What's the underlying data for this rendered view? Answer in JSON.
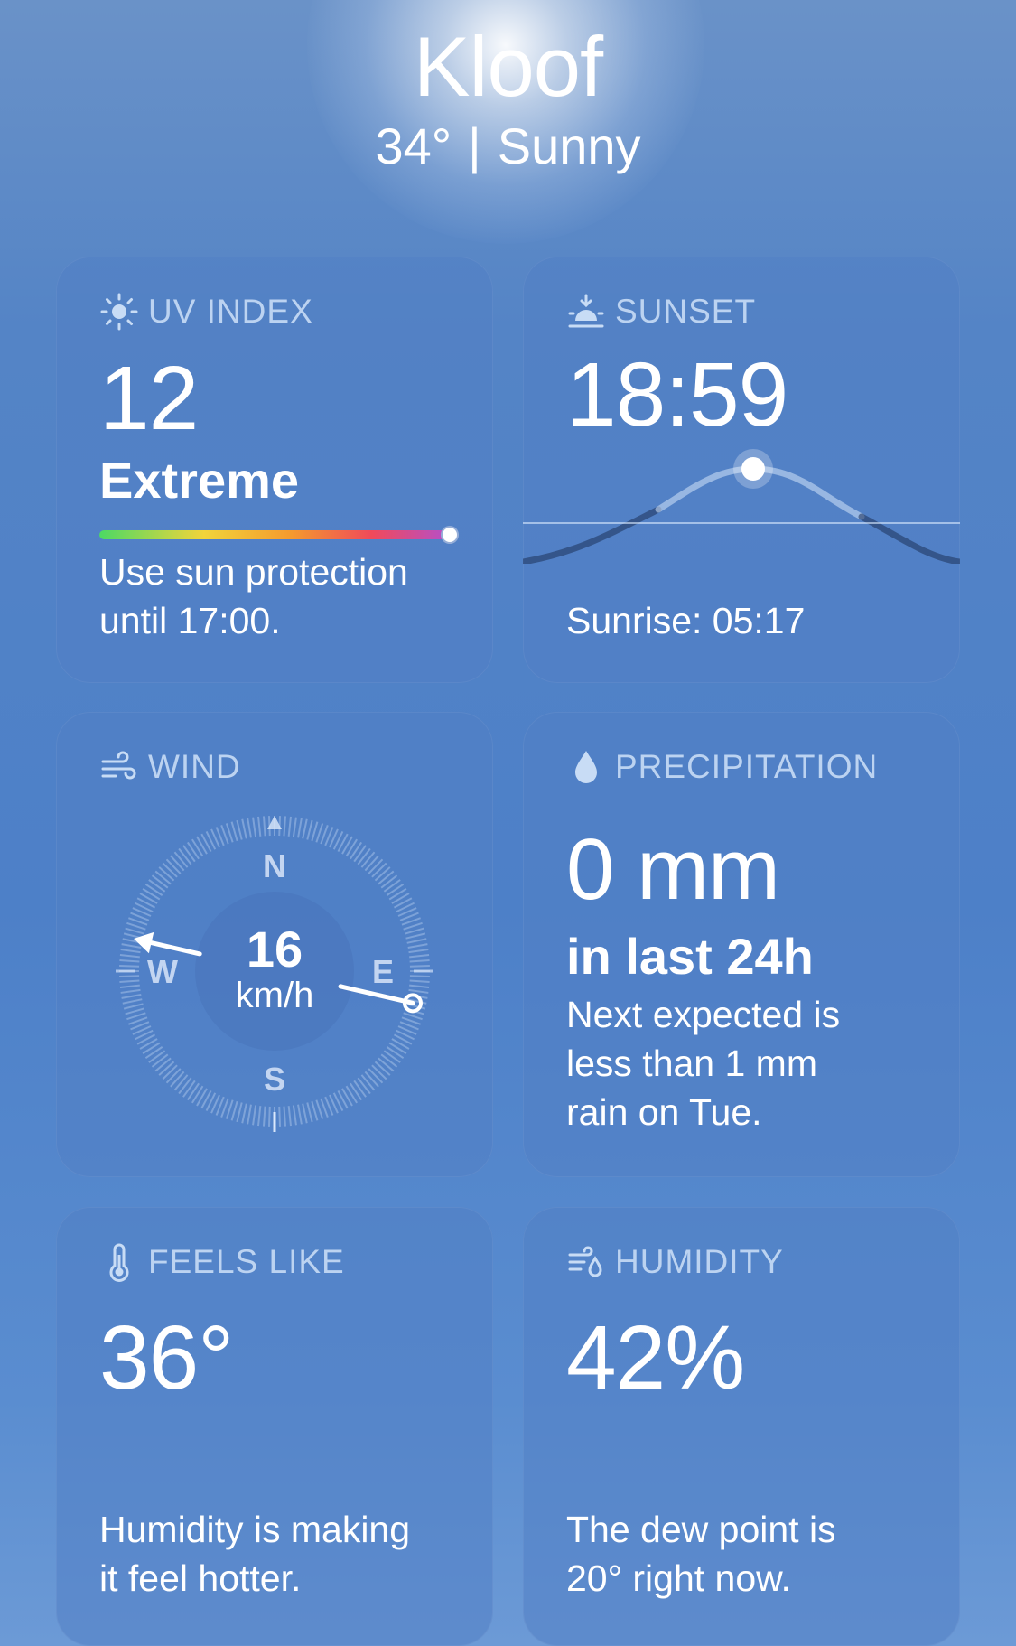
{
  "location": {
    "city": "Kloof",
    "temperature": "34°",
    "separator": "|",
    "condition": "Sunny"
  },
  "uv": {
    "label": "UV INDEX",
    "value": "12",
    "level": "Extreme",
    "line1": "Use sun protection",
    "line2": "until 17:00.",
    "scale_fraction": 1.0
  },
  "sunset": {
    "label": "SUNSET",
    "time": "18:59",
    "sunrise": "Sunrise: 05:17"
  },
  "wind": {
    "label": "WIND",
    "speed": "16",
    "unit": "km/h",
    "north": "N",
    "south": "S",
    "east": "E",
    "west": "W",
    "direction_degrees": 103
  },
  "precipitation": {
    "label": "PRECIPITATION",
    "amount": "0 mm",
    "period": "in last 24h",
    "line1": "Next expected is",
    "line2": "less than 1 mm",
    "line3": "rain on Tue."
  },
  "feels_like": {
    "label": "FEELS LIKE",
    "value": "36°",
    "line1": "Humidity is making",
    "line2": "it feel hotter."
  },
  "humidity": {
    "label": "HUMIDITY",
    "value": "42%",
    "line1": "The dew point is",
    "line2": "20° right now."
  },
  "colors": {
    "label": "#c8dcf5",
    "card": "#5280c4",
    "background": "#4d80c8"
  },
  "icons": {
    "uv": "sun-icon",
    "sunset": "sunset-icon",
    "wind": "wind-icon",
    "precipitation": "drop-icon",
    "feels_like": "thermometer-icon",
    "humidity": "humidity-icon"
  }
}
